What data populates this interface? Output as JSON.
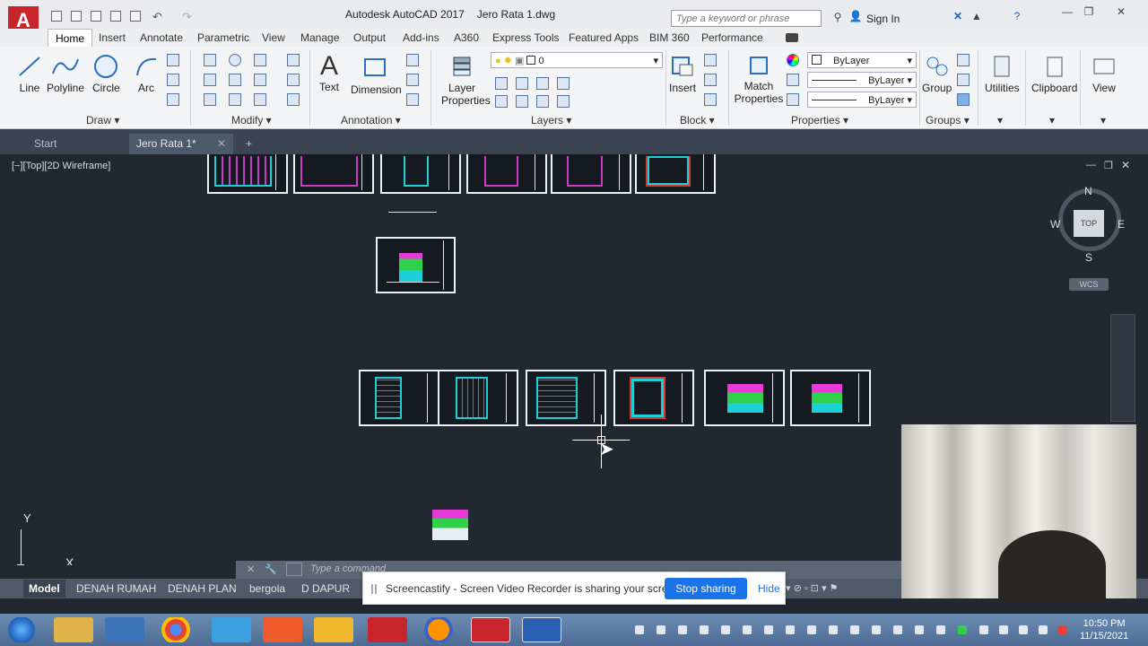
{
  "app": {
    "title": "Autodesk AutoCAD 2017",
    "document": "Jero Rata 1.dwg",
    "logo_letter": "A",
    "search_placeholder": "Type a keyword or phrase",
    "sign_in": "Sign In"
  },
  "ribbon_tabs": [
    "Home",
    "Insert",
    "Annotate",
    "Parametric",
    "View",
    "Manage",
    "Output",
    "Add-ins",
    "A360",
    "Express Tools",
    "Featured Apps",
    "BIM 360",
    "Performance"
  ],
  "ribbon": {
    "draw": {
      "title": "Draw",
      "tools": [
        "Line",
        "Polyline",
        "Circle",
        "Arc"
      ]
    },
    "modify": {
      "title": "Modify"
    },
    "annotation": {
      "title": "Annotation",
      "tools": [
        "Text",
        "Dimension"
      ]
    },
    "layers": {
      "title": "Layers",
      "tool": "Layer Properties",
      "current_layer": "0"
    },
    "block": {
      "title": "Block",
      "tool": "Insert"
    },
    "properties": {
      "title": "Properties",
      "tool": "Match Properties",
      "color": "ByLayer",
      "linetype": "ByLayer",
      "lineweight": "ByLayer"
    },
    "groups": {
      "title": "Groups",
      "tool": "Group"
    },
    "utilities": "Utilities",
    "clipboard": "Clipboard",
    "view": "View"
  },
  "file_tabs": [
    "Start",
    "Jero Rata 1*"
  ],
  "viewport": {
    "label": "[−][Top][2D Wireframe]",
    "compass": {
      "n": "N",
      "s": "S",
      "e": "E",
      "w": "W",
      "top": "TOP"
    },
    "wcs": "WCS",
    "ucs_x": "X",
    "ucs_y": "Y"
  },
  "command_line": {
    "placeholder": "Type a command"
  },
  "layout_tabs": [
    "Model",
    "DENAH RUMAH",
    "DENAH PLAN",
    "bergola",
    "D DAPUR"
  ],
  "share_banner": {
    "text": "Screencastify - Screen Video Recorder is sharing your screen.",
    "stop": "Stop sharing",
    "hide": "Hide"
  },
  "clock": {
    "time": "10:50 PM",
    "date": "11/15/2021"
  },
  "colors": {
    "accent": "#c9252c",
    "banner_button": "#1a73e8",
    "viewport_bg": "#212830"
  }
}
